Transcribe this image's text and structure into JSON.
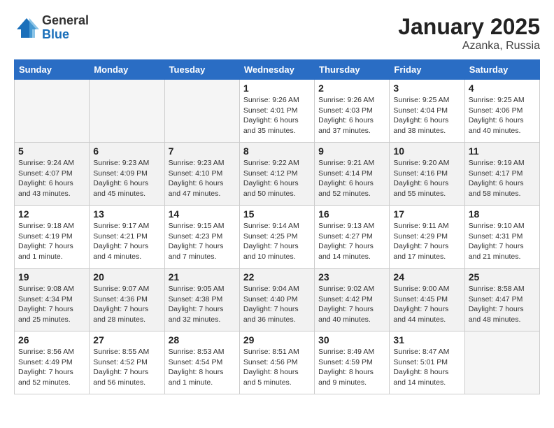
{
  "logo": {
    "general": "General",
    "blue": "Blue"
  },
  "title": {
    "month_year": "January 2025",
    "location": "Azanka, Russia"
  },
  "days_of_week": [
    "Sunday",
    "Monday",
    "Tuesday",
    "Wednesday",
    "Thursday",
    "Friday",
    "Saturday"
  ],
  "weeks": [
    [
      {
        "num": "",
        "info": ""
      },
      {
        "num": "",
        "info": ""
      },
      {
        "num": "",
        "info": ""
      },
      {
        "num": "1",
        "info": "Sunrise: 9:26 AM\nSunset: 4:01 PM\nDaylight: 6 hours\nand 35 minutes."
      },
      {
        "num": "2",
        "info": "Sunrise: 9:26 AM\nSunset: 4:03 PM\nDaylight: 6 hours\nand 37 minutes."
      },
      {
        "num": "3",
        "info": "Sunrise: 9:25 AM\nSunset: 4:04 PM\nDaylight: 6 hours\nand 38 minutes."
      },
      {
        "num": "4",
        "info": "Sunrise: 9:25 AM\nSunset: 4:06 PM\nDaylight: 6 hours\nand 40 minutes."
      }
    ],
    [
      {
        "num": "5",
        "info": "Sunrise: 9:24 AM\nSunset: 4:07 PM\nDaylight: 6 hours\nand 43 minutes."
      },
      {
        "num": "6",
        "info": "Sunrise: 9:23 AM\nSunset: 4:09 PM\nDaylight: 6 hours\nand 45 minutes."
      },
      {
        "num": "7",
        "info": "Sunrise: 9:23 AM\nSunset: 4:10 PM\nDaylight: 6 hours\nand 47 minutes."
      },
      {
        "num": "8",
        "info": "Sunrise: 9:22 AM\nSunset: 4:12 PM\nDaylight: 6 hours\nand 50 minutes."
      },
      {
        "num": "9",
        "info": "Sunrise: 9:21 AM\nSunset: 4:14 PM\nDaylight: 6 hours\nand 52 minutes."
      },
      {
        "num": "10",
        "info": "Sunrise: 9:20 AM\nSunset: 4:16 PM\nDaylight: 6 hours\nand 55 minutes."
      },
      {
        "num": "11",
        "info": "Sunrise: 9:19 AM\nSunset: 4:17 PM\nDaylight: 6 hours\nand 58 minutes."
      }
    ],
    [
      {
        "num": "12",
        "info": "Sunrise: 9:18 AM\nSunset: 4:19 PM\nDaylight: 7 hours\nand 1 minute."
      },
      {
        "num": "13",
        "info": "Sunrise: 9:17 AM\nSunset: 4:21 PM\nDaylight: 7 hours\nand 4 minutes."
      },
      {
        "num": "14",
        "info": "Sunrise: 9:15 AM\nSunset: 4:23 PM\nDaylight: 7 hours\nand 7 minutes."
      },
      {
        "num": "15",
        "info": "Sunrise: 9:14 AM\nSunset: 4:25 PM\nDaylight: 7 hours\nand 10 minutes."
      },
      {
        "num": "16",
        "info": "Sunrise: 9:13 AM\nSunset: 4:27 PM\nDaylight: 7 hours\nand 14 minutes."
      },
      {
        "num": "17",
        "info": "Sunrise: 9:11 AM\nSunset: 4:29 PM\nDaylight: 7 hours\nand 17 minutes."
      },
      {
        "num": "18",
        "info": "Sunrise: 9:10 AM\nSunset: 4:31 PM\nDaylight: 7 hours\nand 21 minutes."
      }
    ],
    [
      {
        "num": "19",
        "info": "Sunrise: 9:08 AM\nSunset: 4:34 PM\nDaylight: 7 hours\nand 25 minutes."
      },
      {
        "num": "20",
        "info": "Sunrise: 9:07 AM\nSunset: 4:36 PM\nDaylight: 7 hours\nand 28 minutes."
      },
      {
        "num": "21",
        "info": "Sunrise: 9:05 AM\nSunset: 4:38 PM\nDaylight: 7 hours\nand 32 minutes."
      },
      {
        "num": "22",
        "info": "Sunrise: 9:04 AM\nSunset: 4:40 PM\nDaylight: 7 hours\nand 36 minutes."
      },
      {
        "num": "23",
        "info": "Sunrise: 9:02 AM\nSunset: 4:42 PM\nDaylight: 7 hours\nand 40 minutes."
      },
      {
        "num": "24",
        "info": "Sunrise: 9:00 AM\nSunset: 4:45 PM\nDaylight: 7 hours\nand 44 minutes."
      },
      {
        "num": "25",
        "info": "Sunrise: 8:58 AM\nSunset: 4:47 PM\nDaylight: 7 hours\nand 48 minutes."
      }
    ],
    [
      {
        "num": "26",
        "info": "Sunrise: 8:56 AM\nSunset: 4:49 PM\nDaylight: 7 hours\nand 52 minutes."
      },
      {
        "num": "27",
        "info": "Sunrise: 8:55 AM\nSunset: 4:52 PM\nDaylight: 7 hours\nand 56 minutes."
      },
      {
        "num": "28",
        "info": "Sunrise: 8:53 AM\nSunset: 4:54 PM\nDaylight: 8 hours\nand 1 minute."
      },
      {
        "num": "29",
        "info": "Sunrise: 8:51 AM\nSunset: 4:56 PM\nDaylight: 8 hours\nand 5 minutes."
      },
      {
        "num": "30",
        "info": "Sunrise: 8:49 AM\nSunset: 4:59 PM\nDaylight: 8 hours\nand 9 minutes."
      },
      {
        "num": "31",
        "info": "Sunrise: 8:47 AM\nSunset: 5:01 PM\nDaylight: 8 hours\nand 14 minutes."
      },
      {
        "num": "",
        "info": ""
      }
    ]
  ]
}
